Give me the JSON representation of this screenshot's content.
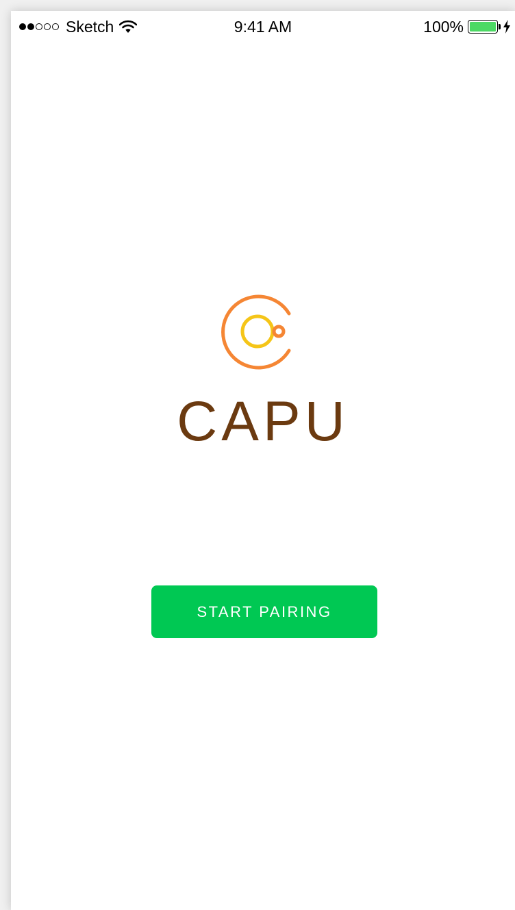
{
  "status_bar": {
    "carrier": "Sketch",
    "signal_bars_filled": 2,
    "signal_bars_total": 5,
    "time": "9:41 AM",
    "battery_percent": "100%",
    "battery_level": 1.0,
    "icons": [
      "signal-dots-icon",
      "wifi-icon",
      "battery-icon",
      "charging-bolt-icon"
    ]
  },
  "logo": {
    "icon": "coffee-cup-logo-icon",
    "text": "CAPU",
    "text_color": "#6b3a10",
    "ring_color": "#f58634",
    "cup_color": "#f5c518"
  },
  "primary_action": {
    "label": "START PAIRING",
    "color": "#00c853"
  }
}
